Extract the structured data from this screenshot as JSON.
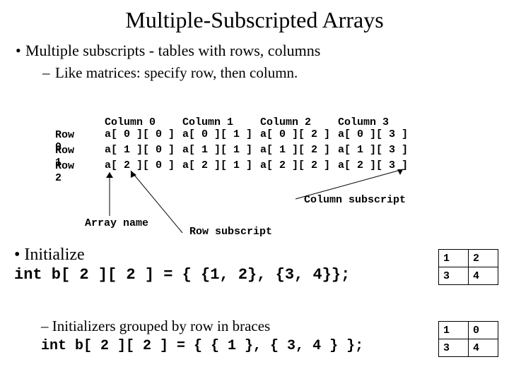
{
  "title": "Multiple-Subscripted Arrays",
  "bullet_main": "Multiple subscripts - tables with rows, columns",
  "bullet_sub": "Like matrices: specify row, then column.",
  "matrix": {
    "row_labels": [
      "Row 0",
      "Row 1",
      "Row 2"
    ],
    "col_headers": [
      "Column 0",
      "Column 1",
      "Column 2",
      "Column 3"
    ],
    "cells": [
      [
        "a[ 0 ][ 0 ]",
        "a[ 0 ][ 1 ]",
        "a[ 0 ][ 2 ]",
        "a[ 0 ][ 3 ]"
      ],
      [
        "a[ 1 ][ 0 ]",
        "a[ 1 ][ 1 ]",
        "a[ 1 ][ 2 ]",
        "a[ 1 ][ 3 ]"
      ],
      [
        "a[ 2 ][ 0 ]",
        "a[ 2 ][ 1 ]",
        "a[ 2 ][ 2 ]",
        "a[ 2 ][ 3 ]"
      ]
    ]
  },
  "annot": {
    "column_subscript": "Column subscript",
    "row_subscript": "Row subscript",
    "array_name": "Array name"
  },
  "init": {
    "heading": "Initialize",
    "code": "int b[ 2 ][ 2 ] = { {1, 2}, {3, 4}};",
    "table": [
      [
        "1",
        "2"
      ],
      [
        "3",
        "4"
      ]
    ]
  },
  "grouped": {
    "text": "Initializers grouped by row in braces",
    "code": "int b[ 2 ][ 2 ] = { { 1 }, { 3, 4 } };",
    "table": [
      [
        "1",
        "0"
      ],
      [
        "3",
        "4"
      ]
    ]
  }
}
